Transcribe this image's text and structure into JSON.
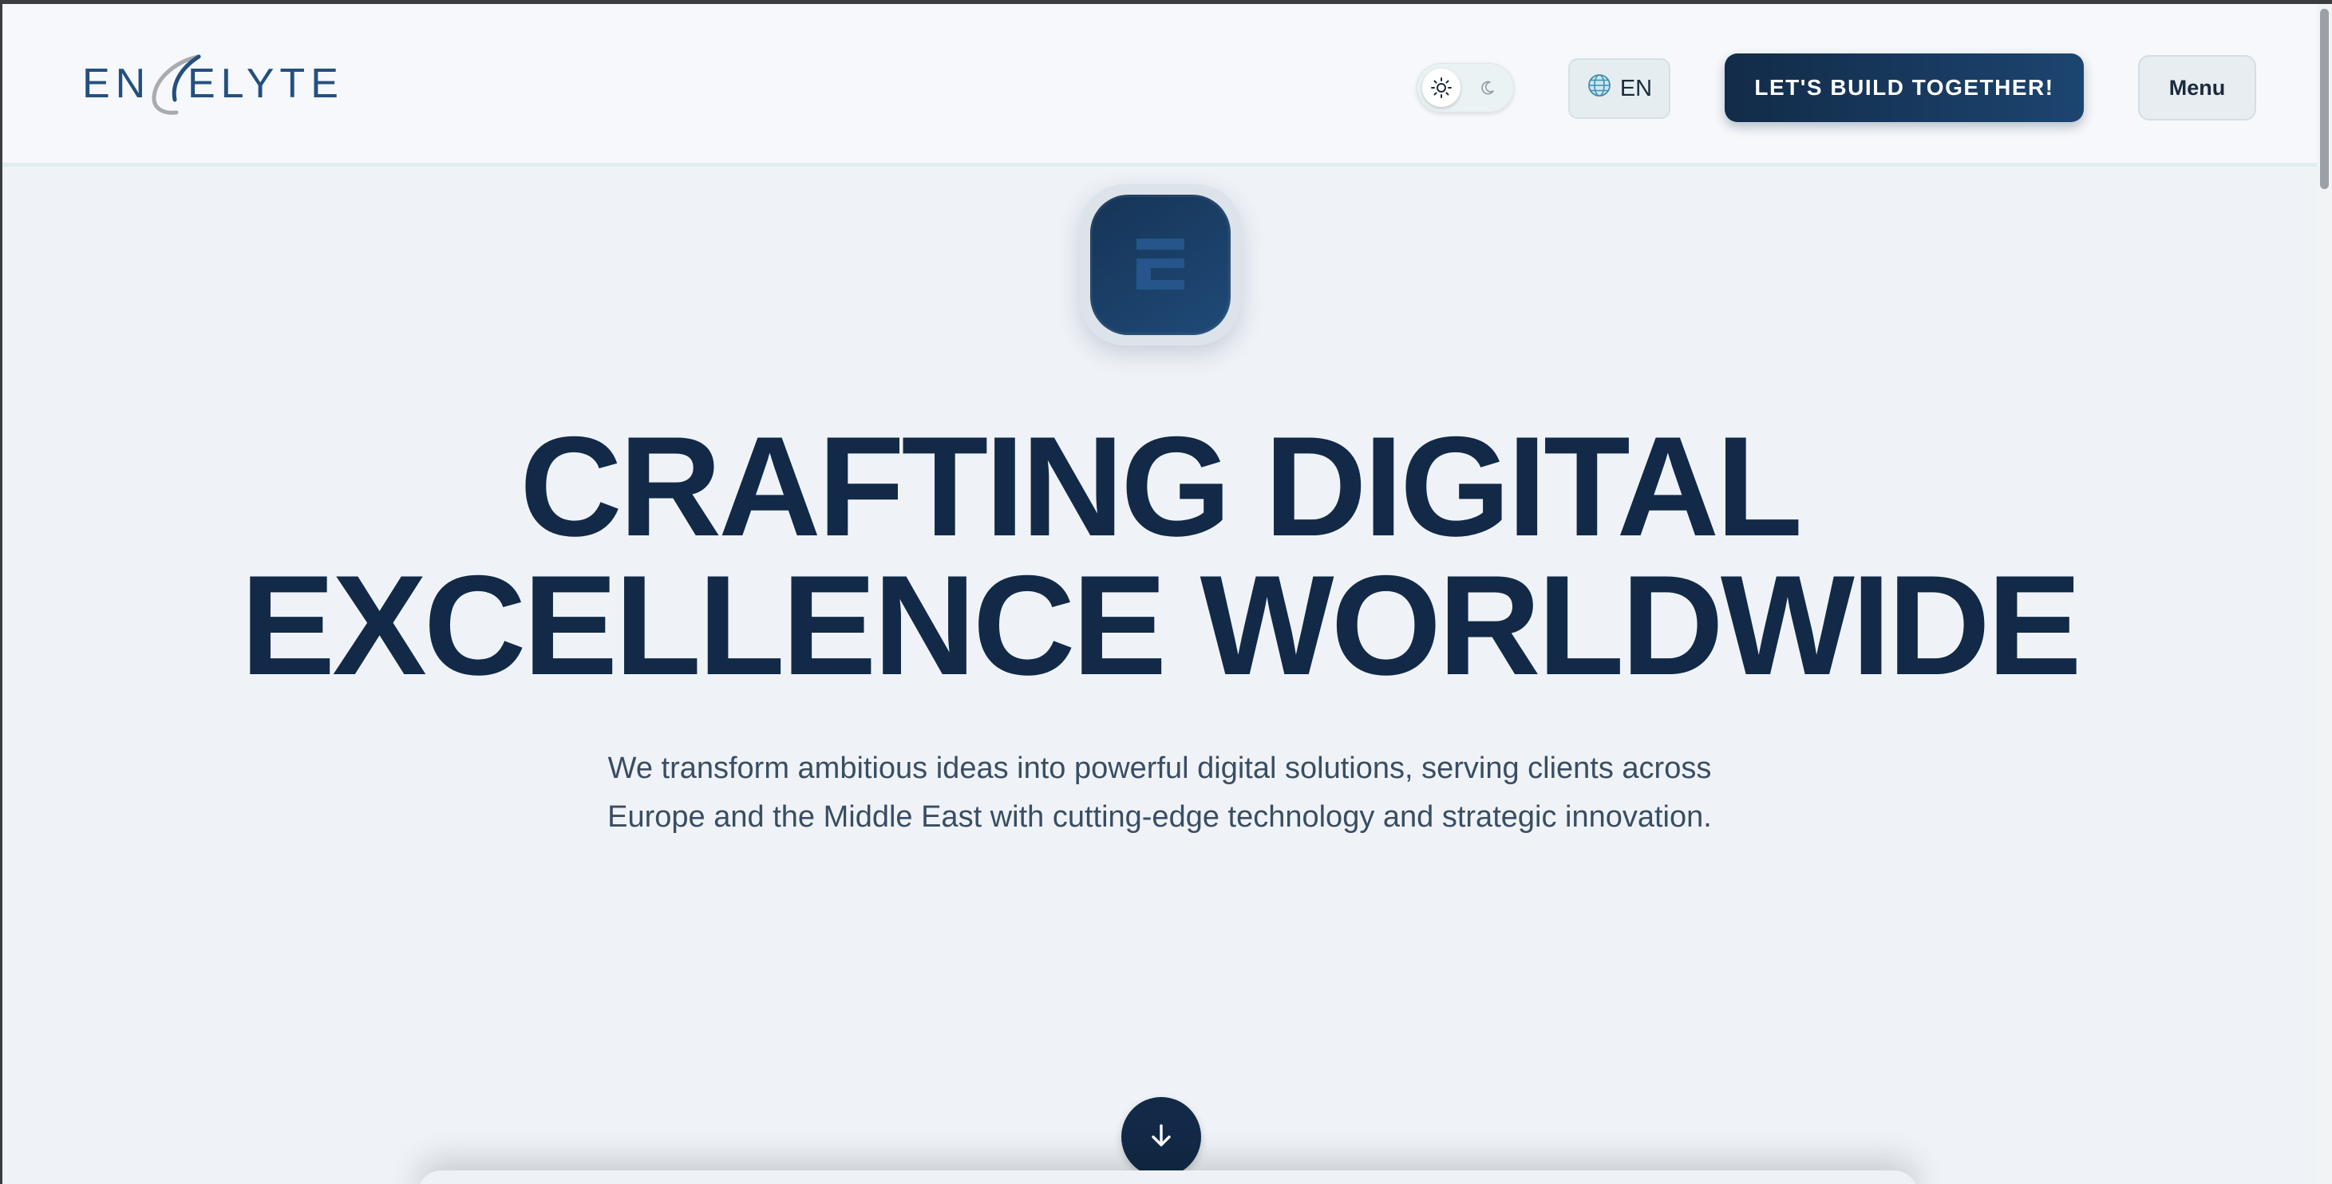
{
  "header": {
    "brand": "ENCELYTE",
    "language_label": "EN",
    "cta_label": "LET'S BUILD TOGETHER!",
    "menu_label": "Menu",
    "theme": "light"
  },
  "hero": {
    "icon_letter": "E",
    "headline_line1": "CRAFTING DIGITAL",
    "headline_line2": "EXCELLENCE WORLDWIDE",
    "subtitle": "We transform ambitious ideas into powerful digital solutions, serving clients across Europe and the Middle East with cutting-edge technology and strategic innovation."
  },
  "colors": {
    "brand_navy": "#122a47",
    "background": "#eff3f8",
    "header_background": "#f6f8fb",
    "subtitle": "#3a4d62"
  },
  "icons": {
    "theme_light": "sun-icon",
    "theme_dark": "moon-icon",
    "language": "globe-icon",
    "scroll": "arrow-down-icon"
  }
}
